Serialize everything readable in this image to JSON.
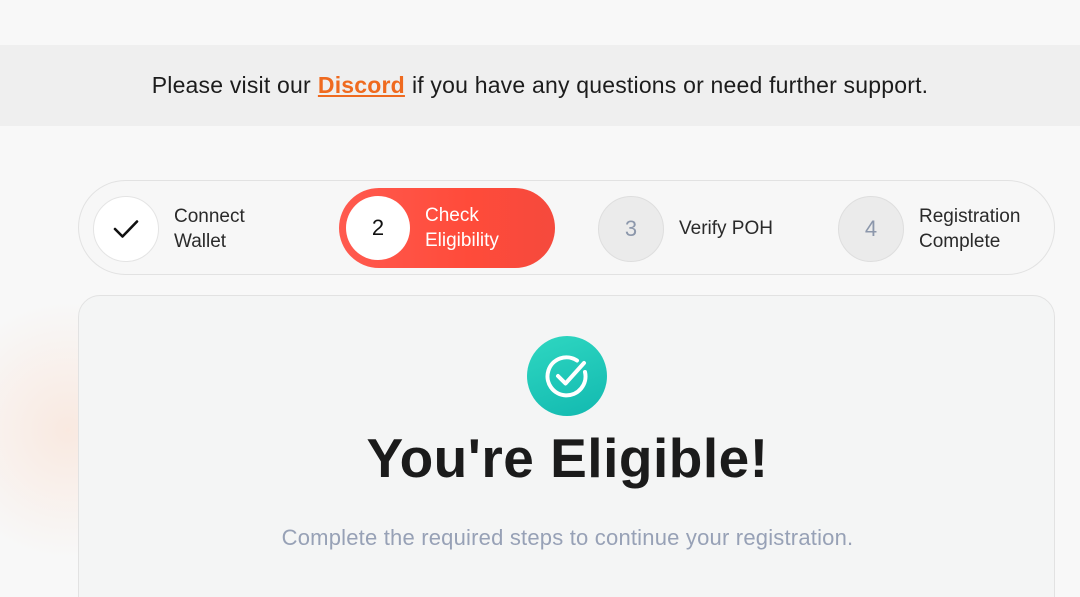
{
  "notice": {
    "prefix": "Please visit our",
    "link_text": "Discord",
    "suffix": "if you have any questions or need further support."
  },
  "stepper": {
    "steps": [
      {
        "number": "",
        "label_line1": "Connect",
        "label_line2": "Wallet",
        "state": "done",
        "icon": "checkmark-icon"
      },
      {
        "number": "2",
        "label_line1": "Check",
        "label_line2": "Eligibility",
        "state": "active"
      },
      {
        "number": "3",
        "label_line1": "Verify POH",
        "label_line2": "",
        "state": "pending"
      },
      {
        "number": "4",
        "label_line1": "Registration",
        "label_line2": "Complete",
        "state": "pending"
      }
    ]
  },
  "card": {
    "icon": "check-circle-icon",
    "title": "You're Eligible!",
    "subtitle": "Complete the required steps to continue your registration."
  },
  "colors": {
    "accent_orange": "#ef6a1f",
    "active_step": "#ff4b3a",
    "success_teal": "#1fc7b8",
    "muted_text": "#97a1b6"
  }
}
